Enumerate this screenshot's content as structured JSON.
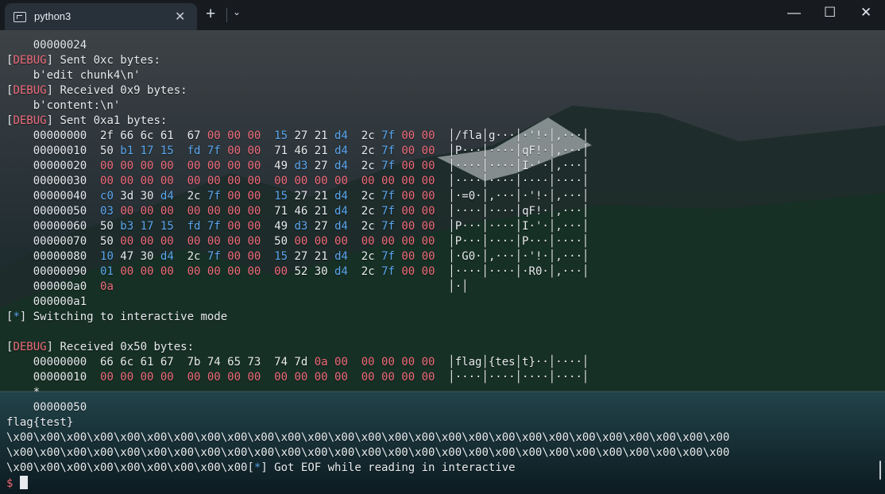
{
  "window": {
    "tab_title": "python3",
    "close_tab_label": "✕",
    "new_tab_label": "+",
    "tab_menu_label": "⌄",
    "minimize_label": "—",
    "maximize_label": "☐",
    "close_label": "✕"
  },
  "terminal": {
    "lines": [
      {
        "parts": [
          {
            "text": "    00000024",
            "cls": "white"
          }
        ]
      },
      {
        "parts": [
          {
            "text": "[",
            "cls": "white"
          },
          {
            "text": "DEBUG",
            "cls": "red"
          },
          {
            "text": "] Sent 0xc bytes:",
            "cls": "white"
          }
        ]
      },
      {
        "parts": [
          {
            "text": "    b'edit chunk4\\n'",
            "cls": "white"
          }
        ]
      },
      {
        "parts": [
          {
            "text": "[",
            "cls": "white"
          },
          {
            "text": "DEBUG",
            "cls": "red"
          },
          {
            "text": "] Received 0x9 bytes:",
            "cls": "white"
          }
        ]
      },
      {
        "parts": [
          {
            "text": "    b'content:\\n'",
            "cls": "white"
          }
        ]
      },
      {
        "parts": [
          {
            "text": "[",
            "cls": "white"
          },
          {
            "text": "DEBUG",
            "cls": "red"
          },
          {
            "text": "] Sent 0xa1 bytes:",
            "cls": "white"
          }
        ]
      },
      {
        "parts": [
          {
            "text": "    00000000  2f 66 6c 61  67 ",
            "cls": "white"
          },
          {
            "text": "00 00 00",
            "cls": "red"
          },
          {
            "text": "  ",
            "cls": "white"
          },
          {
            "text": "15",
            "cls": "blue"
          },
          {
            "text": " 27 21 ",
            "cls": "white"
          },
          {
            "text": "d4",
            "cls": "blue"
          },
          {
            "text": "  2c ",
            "cls": "white"
          },
          {
            "text": "7f",
            "cls": "blue"
          },
          {
            "text": " ",
            "cls": "white"
          },
          {
            "text": "00 00",
            "cls": "red"
          },
          {
            "text": "  │/fla│g···│·'!·│,···│",
            "cls": "white"
          }
        ]
      },
      {
        "parts": [
          {
            "text": "    00000010  50 ",
            "cls": "white"
          },
          {
            "text": "b1 17 15",
            "cls": "blue"
          },
          {
            "text": "  ",
            "cls": "white"
          },
          {
            "text": "fd 7f",
            "cls": "blue"
          },
          {
            "text": " ",
            "cls": "white"
          },
          {
            "text": "00 00",
            "cls": "red"
          },
          {
            "text": "  71 46 21 ",
            "cls": "white"
          },
          {
            "text": "d4",
            "cls": "blue"
          },
          {
            "text": "  2c ",
            "cls": "white"
          },
          {
            "text": "7f",
            "cls": "blue"
          },
          {
            "text": " ",
            "cls": "white"
          },
          {
            "text": "00 00",
            "cls": "red"
          },
          {
            "text": "  │P···│····│qF!·│,···│",
            "cls": "white"
          }
        ]
      },
      {
        "parts": [
          {
            "text": "    00000020  ",
            "cls": "white"
          },
          {
            "text": "00 00 00 00  00 00 00 00",
            "cls": "red"
          },
          {
            "text": "  49 ",
            "cls": "white"
          },
          {
            "text": "d3",
            "cls": "blue"
          },
          {
            "text": " 27 ",
            "cls": "white"
          },
          {
            "text": "d4",
            "cls": "blue"
          },
          {
            "text": "  2c ",
            "cls": "white"
          },
          {
            "text": "7f",
            "cls": "blue"
          },
          {
            "text": " ",
            "cls": "white"
          },
          {
            "text": "00 00",
            "cls": "red"
          },
          {
            "text": "  │····│····│I·'·│,···│",
            "cls": "white"
          }
        ]
      },
      {
        "parts": [
          {
            "text": "    00000030  ",
            "cls": "white"
          },
          {
            "text": "00 00 00 00  00 00 00 00  00 00 00 00  00 00 00 00",
            "cls": "red"
          },
          {
            "text": "  │····│····│····│····│",
            "cls": "white"
          }
        ]
      },
      {
        "parts": [
          {
            "text": "    00000040  ",
            "cls": "white"
          },
          {
            "text": "c0",
            "cls": "blue"
          },
          {
            "text": " 3d 30 ",
            "cls": "white"
          },
          {
            "text": "d4",
            "cls": "blue"
          },
          {
            "text": "  2c ",
            "cls": "white"
          },
          {
            "text": "7f",
            "cls": "blue"
          },
          {
            "text": " ",
            "cls": "white"
          },
          {
            "text": "00 00",
            "cls": "red"
          },
          {
            "text": "  ",
            "cls": "white"
          },
          {
            "text": "15",
            "cls": "blue"
          },
          {
            "text": " 27 21 ",
            "cls": "white"
          },
          {
            "text": "d4",
            "cls": "blue"
          },
          {
            "text": "  2c ",
            "cls": "white"
          },
          {
            "text": "7f",
            "cls": "blue"
          },
          {
            "text": " ",
            "cls": "white"
          },
          {
            "text": "00 00",
            "cls": "red"
          },
          {
            "text": "  │·=0·│,···│·'!·│,···│",
            "cls": "white"
          }
        ]
      },
      {
        "parts": [
          {
            "text": "    00000050  ",
            "cls": "white"
          },
          {
            "text": "03",
            "cls": "blue"
          },
          {
            "text": " ",
            "cls": "white"
          },
          {
            "text": "00 00 00  00 00 00 00",
            "cls": "red"
          },
          {
            "text": "  71 46 21 ",
            "cls": "white"
          },
          {
            "text": "d4",
            "cls": "blue"
          },
          {
            "text": "  2c ",
            "cls": "white"
          },
          {
            "text": "7f",
            "cls": "blue"
          },
          {
            "text": " ",
            "cls": "white"
          },
          {
            "text": "00 00",
            "cls": "red"
          },
          {
            "text": "  │····│····│qF!·│,···│",
            "cls": "white"
          }
        ]
      },
      {
        "parts": [
          {
            "text": "    00000060  50 ",
            "cls": "white"
          },
          {
            "text": "b3 17 15",
            "cls": "blue"
          },
          {
            "text": "  ",
            "cls": "white"
          },
          {
            "text": "fd 7f",
            "cls": "blue"
          },
          {
            "text": " ",
            "cls": "white"
          },
          {
            "text": "00 00",
            "cls": "red"
          },
          {
            "text": "  49 ",
            "cls": "white"
          },
          {
            "text": "d3",
            "cls": "blue"
          },
          {
            "text": " 27 ",
            "cls": "white"
          },
          {
            "text": "d4",
            "cls": "blue"
          },
          {
            "text": "  2c ",
            "cls": "white"
          },
          {
            "text": "7f",
            "cls": "blue"
          },
          {
            "text": " ",
            "cls": "white"
          },
          {
            "text": "00 00",
            "cls": "red"
          },
          {
            "text": "  │P···│····│I·'·│,···│",
            "cls": "white"
          }
        ]
      },
      {
        "parts": [
          {
            "text": "    00000070  50 ",
            "cls": "white"
          },
          {
            "text": "00 00 00  00 00 00 00",
            "cls": "red"
          },
          {
            "text": "  50 ",
            "cls": "white"
          },
          {
            "text": "00 00 00  00 00 00 00",
            "cls": "red"
          },
          {
            "text": "  │P···│····│P···│····│",
            "cls": "white"
          }
        ]
      },
      {
        "parts": [
          {
            "text": "    00000080  ",
            "cls": "white"
          },
          {
            "text": "10",
            "cls": "blue"
          },
          {
            "text": " 47 30 ",
            "cls": "white"
          },
          {
            "text": "d4",
            "cls": "blue"
          },
          {
            "text": "  2c ",
            "cls": "white"
          },
          {
            "text": "7f",
            "cls": "blue"
          },
          {
            "text": " ",
            "cls": "white"
          },
          {
            "text": "00 00",
            "cls": "red"
          },
          {
            "text": "  ",
            "cls": "white"
          },
          {
            "text": "15",
            "cls": "blue"
          },
          {
            "text": " 27 21 ",
            "cls": "white"
          },
          {
            "text": "d4",
            "cls": "blue"
          },
          {
            "text": "  2c ",
            "cls": "white"
          },
          {
            "text": "7f",
            "cls": "blue"
          },
          {
            "text": " ",
            "cls": "white"
          },
          {
            "text": "00 00",
            "cls": "red"
          },
          {
            "text": "  │·G0·│,···│·'!·│,···│",
            "cls": "white"
          }
        ]
      },
      {
        "parts": [
          {
            "text": "    00000090  ",
            "cls": "white"
          },
          {
            "text": "01",
            "cls": "blue"
          },
          {
            "text": " ",
            "cls": "white"
          },
          {
            "text": "00 00 00  00 00 00 00  00",
            "cls": "red"
          },
          {
            "text": " 52 30 ",
            "cls": "white"
          },
          {
            "text": "d4",
            "cls": "blue"
          },
          {
            "text": "  2c ",
            "cls": "white"
          },
          {
            "text": "7f",
            "cls": "blue"
          },
          {
            "text": " ",
            "cls": "white"
          },
          {
            "text": "00 00",
            "cls": "red"
          },
          {
            "text": "  │····│····│·R0·│,···│",
            "cls": "white"
          }
        ]
      },
      {
        "parts": [
          {
            "text": "    000000a0  ",
            "cls": "white"
          },
          {
            "text": "0a",
            "cls": "red"
          },
          {
            "text": "                                                  │·│",
            "cls": "white"
          }
        ]
      },
      {
        "parts": [
          {
            "text": "    000000a1",
            "cls": "white"
          }
        ]
      },
      {
        "parts": [
          {
            "text": "[",
            "cls": "white"
          },
          {
            "text": "*",
            "cls": "blue"
          },
          {
            "text": "] Switching to interactive mode",
            "cls": "white"
          }
        ]
      },
      {
        "parts": [
          {
            "text": "",
            "cls": "white"
          }
        ]
      },
      {
        "parts": [
          {
            "text": "[",
            "cls": "white"
          },
          {
            "text": "DEBUG",
            "cls": "red"
          },
          {
            "text": "] Received 0x50 bytes:",
            "cls": "white"
          }
        ]
      },
      {
        "parts": [
          {
            "text": "    00000000  66 6c 61 67  7b 74 65 73  74 7d ",
            "cls": "white"
          },
          {
            "text": "0a 00  00 00 00 00",
            "cls": "red"
          },
          {
            "text": "  │flag│{tes│t}··│····│",
            "cls": "white"
          }
        ]
      },
      {
        "parts": [
          {
            "text": "    00000010  ",
            "cls": "white"
          },
          {
            "text": "00 00 00 00  00 00 00 00  00 00 00 00  00 00 00 00",
            "cls": "red"
          },
          {
            "text": "  │····│····│····│····│",
            "cls": "white"
          }
        ]
      },
      {
        "parts": [
          {
            "text": "    *",
            "cls": "white"
          }
        ]
      },
      {
        "parts": [
          {
            "text": "    00000050",
            "cls": "white"
          }
        ]
      },
      {
        "parts": [
          {
            "text": "flag{test}",
            "cls": "white"
          }
        ]
      },
      {
        "parts": [
          {
            "text": "\\x00\\x00\\x00\\x00\\x00\\x00\\x00\\x00\\x00\\x00\\x00\\x00\\x00\\x00\\x00\\x00\\x00\\x00\\x00\\x00\\x00\\x00\\x00\\x00\\x00\\x00\\x00",
            "cls": "white"
          }
        ]
      },
      {
        "parts": [
          {
            "text": "\\x00\\x00\\x00\\x00\\x00\\x00\\x00\\x00\\x00\\x00\\x00\\x00\\x00\\x00\\x00\\x00\\x00\\x00\\x00\\x00\\x00\\x00\\x00\\x00\\x00\\x00\\x00",
            "cls": "white"
          }
        ]
      },
      {
        "parts": [
          {
            "text": "\\x00\\x00\\x00\\x00\\x00\\x00\\x00\\x00\\x00",
            "cls": "white"
          },
          {
            "text": "[",
            "cls": "white"
          },
          {
            "text": "*",
            "cls": "blue"
          },
          {
            "text": "] Got EOF while reading in interactive",
            "cls": "white"
          }
        ]
      }
    ],
    "prompt": "$"
  },
  "colors": {
    "red": "#ee6a7a",
    "blue": "#5aa6ef",
    "white": "#e7ebee",
    "titlebar": "#171b20",
    "tab": "#283039"
  },
  "icons": {
    "tab_icon": "terminal-icon",
    "close": "close-icon",
    "new": "plus-icon",
    "dropdown": "chevron-down-icon",
    "minimize": "minimize-icon",
    "maximize": "maximize-icon",
    "window_close": "close-icon"
  }
}
